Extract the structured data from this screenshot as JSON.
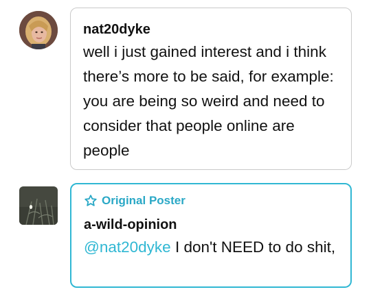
{
  "replies": [
    {
      "username": "nat20dyke",
      "text": "well i just gained interest and i think there’s more to be said, for example: you are being so weird and need to consider that people online are people",
      "avatar_icon": "person-photo-avatar",
      "border_color": "#c9c9c9"
    },
    {
      "badge_icon": "star-outline-icon",
      "badge_label": "Original Poster",
      "username": "a-wild-opinion",
      "mention": "@nat20dyke",
      "text": " I don't NEED to do shit,",
      "avatar_icon": "night-grass-photo-avatar",
      "border_color": "#2fb7d3"
    }
  ],
  "colors": {
    "accent": "#2fb7d3",
    "text": "#111111",
    "border": "#c9c9c9"
  }
}
